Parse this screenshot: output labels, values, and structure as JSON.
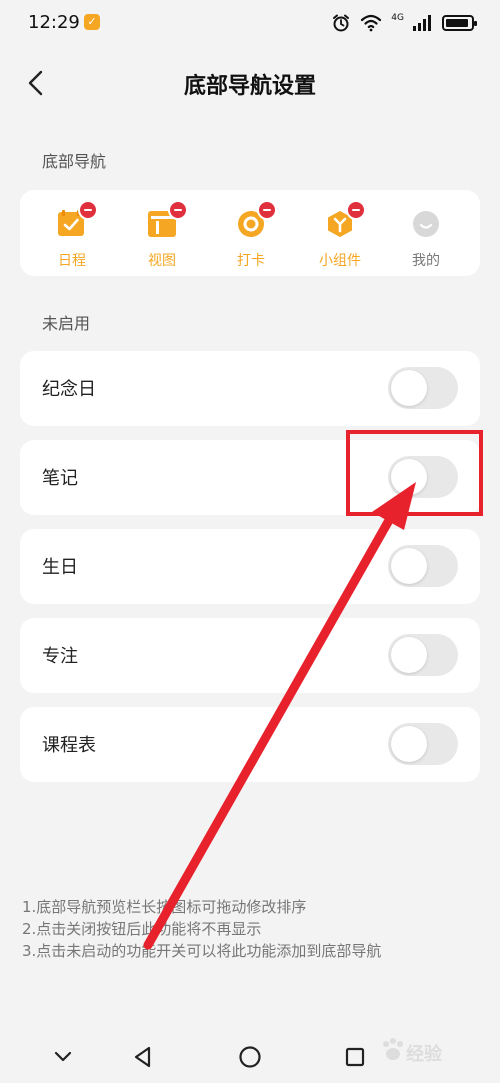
{
  "status_bar": {
    "time": "12:29",
    "badge_icon": "check-icon",
    "network_label": "4G",
    "icons": [
      "alarm-icon",
      "wifi-icon",
      "signal-icon",
      "battery-icon"
    ]
  },
  "header": {
    "title": "底部导航设置",
    "back_icon": "back-arrow-icon"
  },
  "nav_section": {
    "label": "底部导航",
    "items": [
      {
        "label": "日程",
        "icon": "schedule-icon",
        "enabled": true,
        "removable": true
      },
      {
        "label": "视图",
        "icon": "view-icon",
        "enabled": true,
        "removable": true
      },
      {
        "label": "打卡",
        "icon": "checkin-icon",
        "enabled": true,
        "removable": true
      },
      {
        "label": "小组件",
        "icon": "widget-icon",
        "enabled": true,
        "removable": true
      },
      {
        "label": "我的",
        "icon": "profile-icon",
        "enabled": false,
        "removable": false
      }
    ]
  },
  "disabled_section": {
    "label": "未启用",
    "items": [
      {
        "label": "纪念日",
        "on": false
      },
      {
        "label": "笔记",
        "on": false
      },
      {
        "label": "生日",
        "on": false
      },
      {
        "label": "专注",
        "on": false
      },
      {
        "label": "课程表",
        "on": false
      }
    ]
  },
  "tips": [
    "1.底部导航预览栏长按图标可拖动修改排序",
    "2.点击关闭按钮后此功能将不再显示",
    "3.点击未启动的功能开关可以将此功能添加到底部导航"
  ],
  "system_nav": [
    "chevron-down-icon",
    "back-triangle-icon",
    "home-circle-icon",
    "recents-square-icon"
  ],
  "watermark": {
    "text": "经验",
    "logo": "baidu-paw-icon"
  },
  "colors": {
    "accent": "#f5a623",
    "remove_badge": "#e0303e",
    "annotation": "#e8222d",
    "toggle_off": "#e8e8e8",
    "background": "#f3f3f3"
  }
}
